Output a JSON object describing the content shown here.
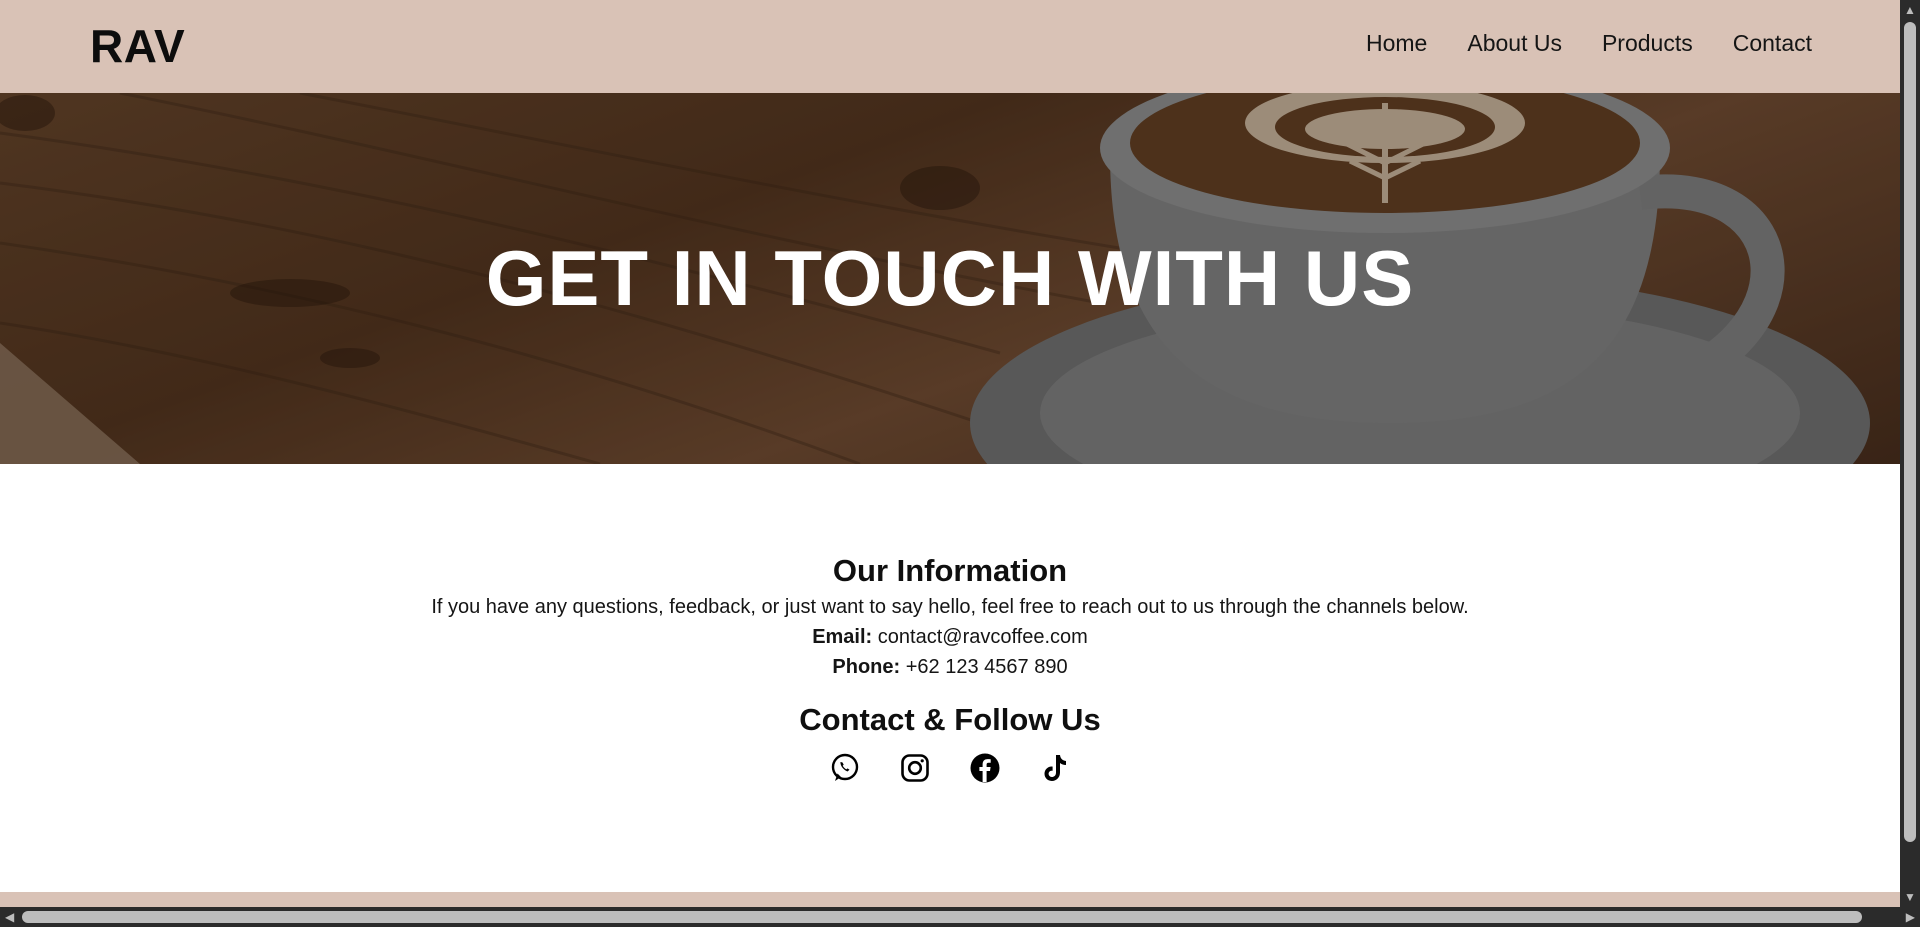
{
  "header": {
    "brand": "RAV",
    "nav": [
      "Home",
      "About Us",
      "Products",
      "Contact"
    ]
  },
  "hero": {
    "title": "GET IN TOUCH WITH US"
  },
  "info": {
    "heading": "Our Information",
    "description": "If you have any questions, feedback, or just want to say hello, feel free to reach out to us through the channels below.",
    "email_label": "Email:",
    "email_value": "contact@ravcoffee.com",
    "phone_label": "Phone:",
    "phone_value": "+62 123 4567 890",
    "follow_heading": "Contact & Follow Us",
    "socials": [
      "whatsapp-icon",
      "instagram-icon",
      "facebook-icon",
      "tiktok-icon"
    ]
  },
  "colors": {
    "nav_bg": "#d9c2b6",
    "hero_text": "#ffffff"
  }
}
